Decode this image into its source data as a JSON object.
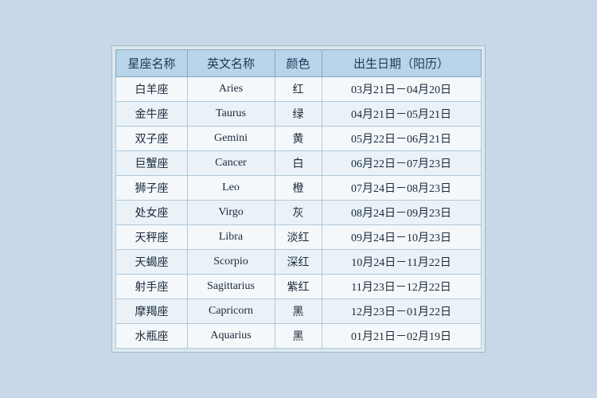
{
  "header": {
    "col1": "星座名称",
    "col2": "英文名称",
    "col3": "颜色",
    "col4": "出生日期（阳历）"
  },
  "rows": [
    {
      "chinese": "白羊座",
      "english": "Aries",
      "color": "红",
      "date": "03月21日－04月20日"
    },
    {
      "chinese": "金牛座",
      "english": "Taurus",
      "color": "绿",
      "date": "04月21日－05月21日"
    },
    {
      "chinese": "双子座",
      "english": "Gemini",
      "color": "黄",
      "date": "05月22日－06月21日"
    },
    {
      "chinese": "巨蟹座",
      "english": "Cancer",
      "color": "白",
      "date": "06月22日－07月23日"
    },
    {
      "chinese": "狮子座",
      "english": "Leo",
      "color": "橙",
      "date": "07月24日－08月23日"
    },
    {
      "chinese": "处女座",
      "english": "Virgo",
      "color": "灰",
      "date": "08月24日－09月23日"
    },
    {
      "chinese": "天秤座",
      "english": "Libra",
      "color": "淡红",
      "date": "09月24日－10月23日"
    },
    {
      "chinese": "天蝎座",
      "english": "Scorpio",
      "color": "深红",
      "date": "10月24日－11月22日"
    },
    {
      "chinese": "射手座",
      "english": "Sagittarius",
      "color": "紫红",
      "date": "11月23日－12月22日"
    },
    {
      "chinese": "摩羯座",
      "english": "Capricorn",
      "color": "黑",
      "date": "12月23日－01月22日"
    },
    {
      "chinese": "水瓶座",
      "english": "Aquarius",
      "color": "黑",
      "date": "01月21日－02月19日"
    }
  ]
}
